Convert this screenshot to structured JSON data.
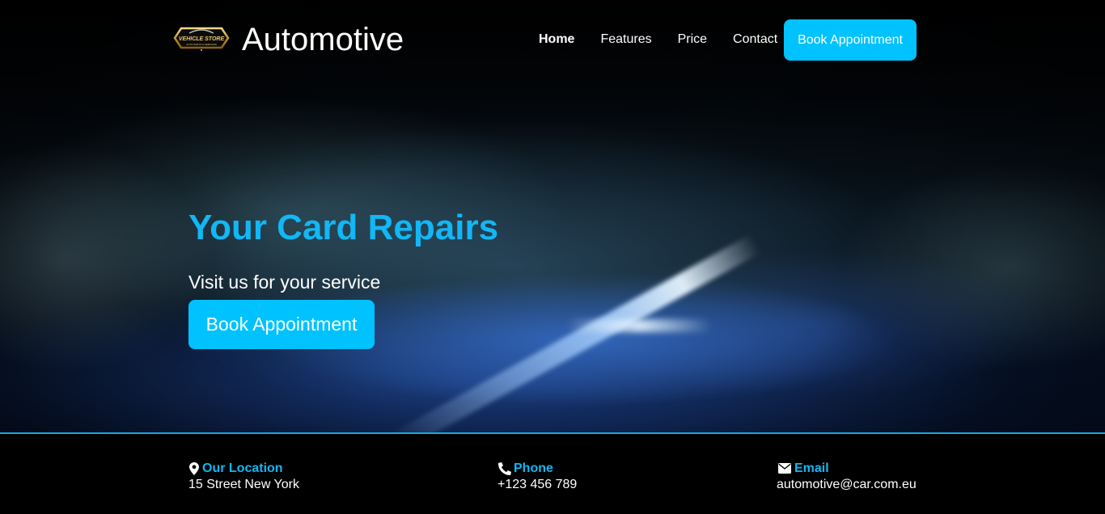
{
  "brand": {
    "logo_text": "VEHICLE STORE",
    "logo_subtext": "AUTO PARTS & SERVICES",
    "title": "Automotive"
  },
  "nav": {
    "items": [
      {
        "label": "Home",
        "active": true
      },
      {
        "label": "Features",
        "active": false
      },
      {
        "label": "Price",
        "active": false
      },
      {
        "label": "Contact",
        "active": false
      }
    ],
    "cta_label": "Book Appointment"
  },
  "hero": {
    "title": "Your Card Repairs",
    "subtitle": "Visit us for your service",
    "cta_label": "Book Appointment"
  },
  "info": {
    "location": {
      "label": "Our Location",
      "value": "15 Street New York",
      "icon": "map-marker-icon"
    },
    "phone": {
      "label": "Phone",
      "value": "+123 456 789",
      "icon": "phone-icon"
    },
    "email": {
      "label": "Email",
      "value": "automotive@car.com.eu",
      "icon": "envelope-icon"
    }
  },
  "colors": {
    "accent": "#00c2ff",
    "heading_accent": "#12b7f5",
    "divider": "#1aa7e0",
    "background": "#000000"
  }
}
